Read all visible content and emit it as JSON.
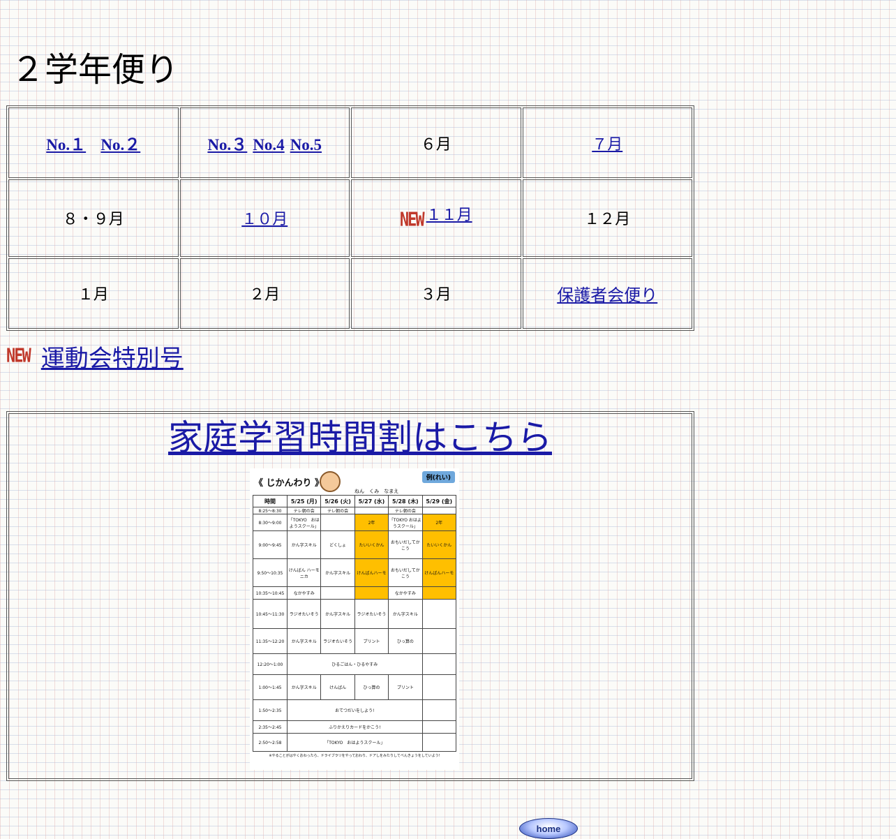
{
  "page": {
    "title": "２学年便り"
  },
  "grid": {
    "row1": {
      "links_a": [
        "No.１",
        "No.２"
      ],
      "links_b": [
        "No.３",
        "No.4",
        "No.5"
      ],
      "june": "６月",
      "july": "７月"
    },
    "row2": {
      "aug_sep": "８・９月",
      "oct": "１０月",
      "new_badge": "NEW",
      "nov": "１１月",
      "dec": "１２月"
    },
    "row3": {
      "jan": "１月",
      "feb": "２月",
      "mar": "３月",
      "guardian": "保護者会便り"
    }
  },
  "sports": {
    "new_badge": "NEW",
    "label": "運動会特別号"
  },
  "home_study": {
    "link": "家庭学習時間割はこちら",
    "schedule": {
      "title": "《 じかんわり 》",
      "example": "例(れい)",
      "name_line": "ねん　くみ　なまえ",
      "header": [
        "時間",
        "5/25 (月)",
        "5/26 (火)",
        "5/27 (水)",
        "5/28 (木)",
        "5/29 (金)"
      ],
      "rows": [
        {
          "time": "8:25〜8:30",
          "cells": [
            "テレ朝の会",
            "テレ朝の会",
            "",
            "テレ朝の会",
            ""
          ]
        },
        {
          "time": "8:30〜9:00",
          "cells": [
            "「TOKYO　おはようスクール」",
            "",
            "2年",
            "「TOKYO おはようスクール」",
            "2年"
          ]
        },
        {
          "time": "9:00〜9:45",
          "cells": [
            "かん字スキル",
            "どくしょ",
            "たいいくかん",
            "おもいだしてかこう",
            "たいいくかん"
          ]
        },
        {
          "time": "9:50〜10:35",
          "cells": [
            "けんばん ハーモニカ",
            "かん字スキル",
            "けんばんハーモ",
            "おもいだしてかこう",
            "けんばんハーモ"
          ]
        },
        {
          "time": "10:35〜10:45",
          "cells": [
            "なかやすみ",
            "",
            "",
            "なかやすみ",
            ""
          ]
        },
        {
          "time": "10:45〜11:30",
          "cells": [
            "ラジオたいそう",
            "かん字スキル",
            "ラジオたいそう",
            "かん字スキル",
            ""
          ]
        },
        {
          "time": "11:35〜12:20",
          "cells": [
            "かん字スキル",
            "ラジオたいそう",
            "プリント",
            "ひっ算の",
            ""
          ]
        },
        {
          "time": "12:20〜1:00",
          "cells": [
            "ひるごはん・ひるやすみ",
            "",
            "",
            "",
            ""
          ]
        },
        {
          "time": "1:00〜1:45",
          "cells": [
            "かん字スキル",
            "けんばん",
            "ひっ算の",
            "プリント",
            ""
          ]
        },
        {
          "time": "1:50〜2:35",
          "cells": [
            "おてつだいをしよう!",
            "",
            "",
            "",
            ""
          ]
        },
        {
          "time": "2:35〜2:45",
          "cells": [
            "ふりかえりカードをかこう!",
            "",
            "",
            "",
            ""
          ]
        },
        {
          "time": "2:50〜2:58",
          "cells": [
            "「TOKYO　おはようスクール」",
            "",
            "",
            "",
            ""
          ]
        }
      ],
      "footer": "※やることがはやくおわったら、ドライブラリをやっておわり、ドアしをみたりしてべんきょうをしていよう!"
    }
  },
  "home_button": {
    "label": "home"
  },
  "colors": {
    "link": "#1a1aa6",
    "new_badge": "#c0392b",
    "highlight": "#ffbf00"
  }
}
